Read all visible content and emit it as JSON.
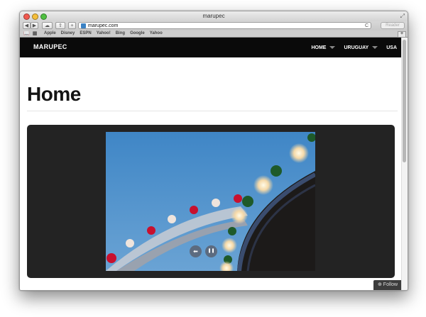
{
  "window": {
    "title": "marupec"
  },
  "toolbar": {
    "back_label": "◀",
    "forward_label": "▶",
    "address_value": "marupec.com",
    "reload_label": "C",
    "reader_label": "Reader"
  },
  "bookmarks": [
    "Apple",
    "Disney",
    "ESPN",
    "Yahoo!",
    "Bing",
    "Google",
    "Yahoo"
  ],
  "site": {
    "logo": "MARUPEC",
    "nav": [
      {
        "label": "HOME",
        "has_dropdown": true
      },
      {
        "label": "URUGUAY",
        "has_dropdown": true
      },
      {
        "label": "USA",
        "has_dropdown": false
      }
    ],
    "page_title": "Home",
    "slideshow": {
      "prev_label": "⬅",
      "pause_label": "❚❚"
    },
    "follow_label": "Follow"
  },
  "colors": {
    "navbar": "#0a0a0a",
    "slider_bg": "#232323",
    "sky": "#3f86c6"
  }
}
